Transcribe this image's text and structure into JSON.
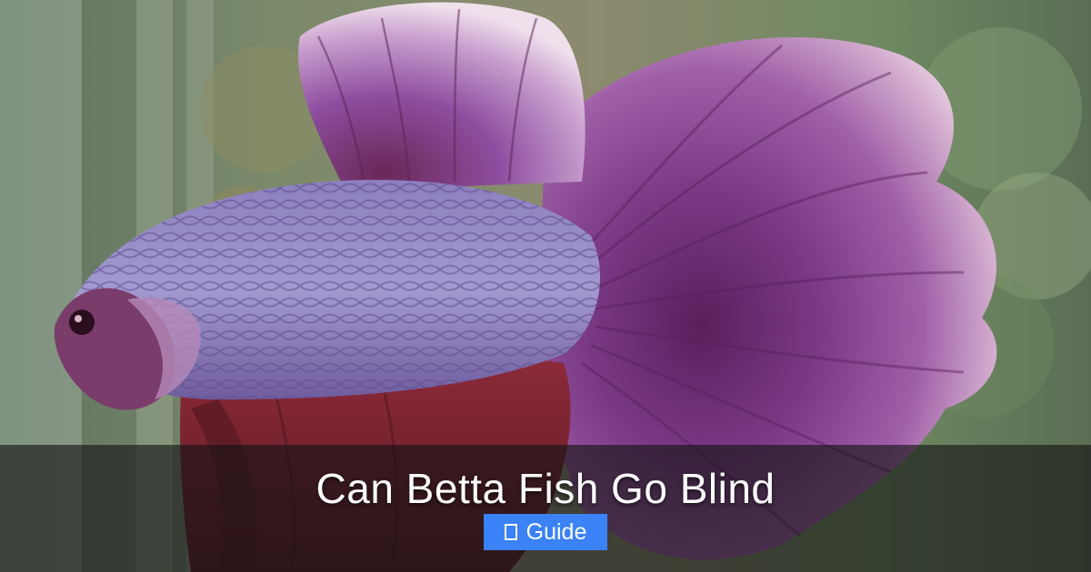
{
  "title": "Can Betta Fish Go Blind",
  "badge": {
    "label": "Guide",
    "icon": "missing-glyph-icon",
    "color": "#3b82f6"
  },
  "colors": {
    "overlay": "#141414",
    "text": "#ffffff"
  }
}
